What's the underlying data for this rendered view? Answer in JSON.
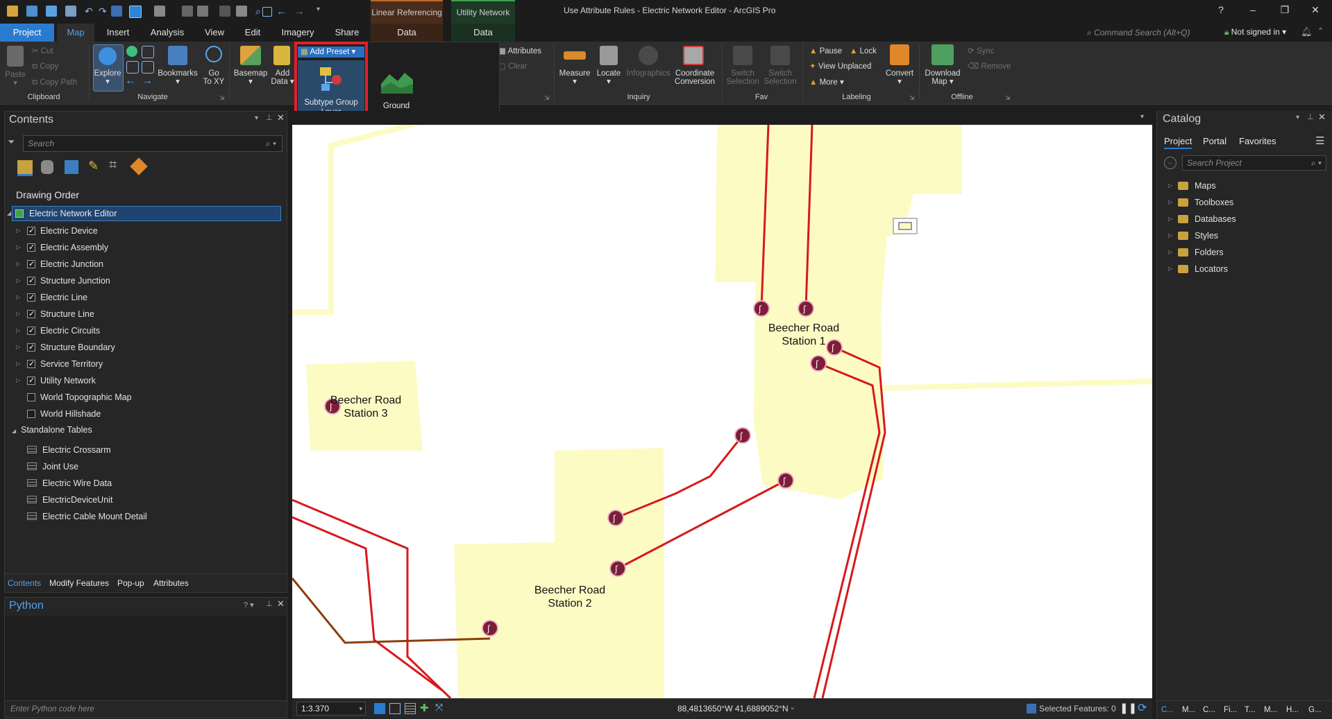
{
  "window": {
    "title": "Use Attribute Rules - Electric Network Editor - ArcGIS Pro",
    "help": "?",
    "minimize": "–",
    "restore": "❐",
    "close": "✕"
  },
  "contextual": {
    "linear_referencing": "Linear Referencing",
    "utility_network": "Utility Network",
    "lr_tab": "Data",
    "un_tab": "Data"
  },
  "tabs": [
    "Project",
    "Map",
    "Insert",
    "Analysis",
    "View",
    "Edit",
    "Imagery",
    "Share"
  ],
  "command_search": {
    "placeholder": "Command Search (Alt+Q)"
  },
  "signin": "Not signed in",
  "ribbon": {
    "clipboard": {
      "paste": "Paste",
      "cut": "Cut",
      "copy": "Copy",
      "copy_path": "Copy Path",
      "group": "Clipboard"
    },
    "navigate": {
      "explore": "Explore",
      "bookmarks": "Bookmarks",
      "goto_1": "Go",
      "goto_2": "To XY",
      "group": "Navigate"
    },
    "layer": {
      "basemap": "Basemap",
      "add_data_1": "Add",
      "add_data_2": "Data"
    },
    "selection": {
      "attributes": "Attributes",
      "clear": "Clear"
    },
    "inquiry": {
      "measure": "Measure",
      "locate": "Locate",
      "infographics": "Infographics",
      "coord_1": "Coordinate",
      "coord_2": "Conversion",
      "group": "Inquiry"
    },
    "fav": {
      "switch1_a": "Switch",
      "switch1_b": "Selection",
      "switch2_a": "Switch",
      "switch2_b": "Selection",
      "group": "Fav"
    },
    "labeling": {
      "pause": "Pause",
      "lock": "Lock",
      "view_unplaced": "View Unplaced",
      "more": "More",
      "convert": "Convert",
      "group": "Labeling"
    },
    "offline": {
      "download_1": "Download",
      "download_2": "Map",
      "sync": "Sync",
      "remove": "Remove",
      "group": "Offline"
    }
  },
  "gallery": {
    "add_preset": "Add Preset",
    "item1_a": "Subtype Group",
    "item1_b": "Layer",
    "item2": "Ground"
  },
  "contents": {
    "title": "Contents",
    "search_placeholder": "Search",
    "drawing_order": "Drawing Order",
    "map_name": "Electric Network Editor",
    "layers": [
      {
        "name": "Electric Device",
        "checked": true
      },
      {
        "name": "Electric Assembly",
        "checked": true
      },
      {
        "name": "Electric Junction",
        "checked": true
      },
      {
        "name": "Structure Junction",
        "checked": true
      },
      {
        "name": "Electric Line",
        "checked": true
      },
      {
        "name": "Structure Line",
        "checked": true
      },
      {
        "name": "Electric Circuits",
        "checked": true
      },
      {
        "name": "Structure Boundary",
        "checked": true
      },
      {
        "name": "Service Territory",
        "checked": true
      },
      {
        "name": "Utility Network",
        "checked": true
      },
      {
        "name": "World Topographic Map",
        "checked": false
      },
      {
        "name": "World Hillshade",
        "checked": false
      }
    ],
    "standalone_tables": "Standalone Tables",
    "tables": [
      "Electric Crossarm",
      "Joint Use",
      "Electric Wire Data",
      "ElectricDeviceUnit",
      "Electric Cable Mount Detail"
    ],
    "bottom_tabs": [
      "Contents",
      "Modify Features",
      "Pop-up",
      "Attributes"
    ]
  },
  "python": {
    "title": "Python",
    "placeholder": "Enter Python code here"
  },
  "catalog": {
    "title": "Catalog",
    "tabs": [
      "Project",
      "Portal",
      "Favorites"
    ],
    "search_placeholder": "Search Project",
    "items": [
      "Maps",
      "Toolboxes",
      "Databases",
      "Styles",
      "Folders",
      "Locators"
    ],
    "bottom_tabs": [
      "C...",
      "M...",
      "C...",
      "Fi...",
      "T...",
      "M...",
      "H...",
      "G..."
    ]
  },
  "map": {
    "stations": [
      {
        "line1": "Beecher Road",
        "line2": "Station 1"
      },
      {
        "line1": "Beecher Road",
        "line2": "Station 2"
      },
      {
        "line1": "Beecher Road",
        "line2": "Station 3"
      }
    ],
    "colors": {
      "polygon": "#fdfbc4",
      "line": "#d7191c",
      "brown_line": "#8c3d0c",
      "node": "#7d1d3a"
    }
  },
  "status": {
    "scale": "1:3.370",
    "coordinates": "88,4813650°W 41,6889052°N",
    "selected": "Selected Features: 0"
  }
}
